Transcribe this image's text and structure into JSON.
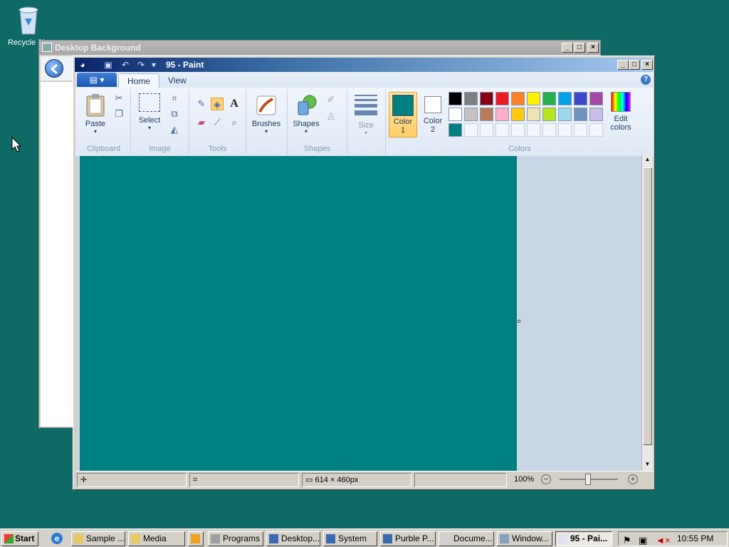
{
  "desktop": {
    "recycle_label": "Recycle Bin"
  },
  "background_window": {
    "title": "Desktop Background"
  },
  "paint": {
    "title": "95 - Paint",
    "tabs": [
      "Home",
      "View"
    ],
    "groups": {
      "clipboard": {
        "label": "Clipboard",
        "paste": "Paste"
      },
      "image": {
        "label": "Image",
        "select": "Select"
      },
      "tools": {
        "label": "Tools"
      },
      "shapes": {
        "label": "Shapes",
        "brushes": "Brushes",
        "shapes": "Shapes"
      },
      "size": {
        "label": "Size"
      },
      "colors": {
        "label": "Colors",
        "color1": "Color\n1",
        "color1_l1": "Color",
        "color1_l2": "1",
        "color2_l1": "Color",
        "color2_l2": "2",
        "edit_l1": "Edit",
        "edit_l2": "colors",
        "color1_value": "#008080",
        "color2_value": "#ffffff"
      }
    },
    "palette_row1": [
      "#000000",
      "#7f7f7f",
      "#880015",
      "#ed1c24",
      "#ff7f27",
      "#fff200",
      "#22b14c",
      "#00a2e8",
      "#3f48cc",
      "#a349a4"
    ],
    "palette_row2": [
      "#ffffff",
      "#c3c3c3",
      "#b97a57",
      "#ffaec9",
      "#ffc90e",
      "#efe4b0",
      "#b5e61d",
      "#99d9ea",
      "#7092be",
      "#c8bfe7"
    ],
    "palette_row3": [
      "#008080",
      "",
      "",
      "",
      "",
      "",
      "",
      "",
      "",
      ""
    ],
    "canvas_color": "#008080",
    "status": {
      "size": "614 × 460px",
      "zoom": "100%"
    }
  },
  "taskbar": {
    "start": "Start",
    "items": [
      "Sample ...",
      "Media",
      "",
      "Programs",
      "Desktop...",
      "System",
      "Purble P...",
      "Docume...",
      "Window...",
      "95 - Pai..."
    ],
    "clock": "10:55 PM"
  }
}
